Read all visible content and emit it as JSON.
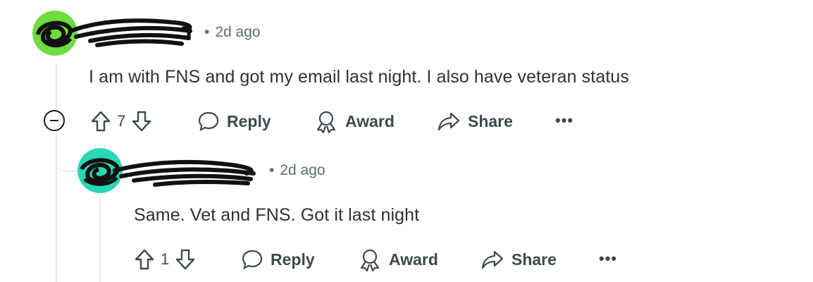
{
  "comments": [
    {
      "time": "2d ago",
      "body": "I am with FNS and got my email last night. I also have veteran status",
      "votes": "7",
      "actions": {
        "reply": "Reply",
        "award": "Award",
        "share": "Share",
        "more": "•••"
      },
      "avatar_color": "#6ddc3f"
    },
    {
      "time": "2d ago",
      "body": "Same. Vet and FNS. Got it last night",
      "votes": "1",
      "actions": {
        "reply": "Reply",
        "award": "Award",
        "share": "Share",
        "more": "•••"
      },
      "avatar_color": "#2ad8b4"
    }
  ],
  "meta_separator": "•"
}
